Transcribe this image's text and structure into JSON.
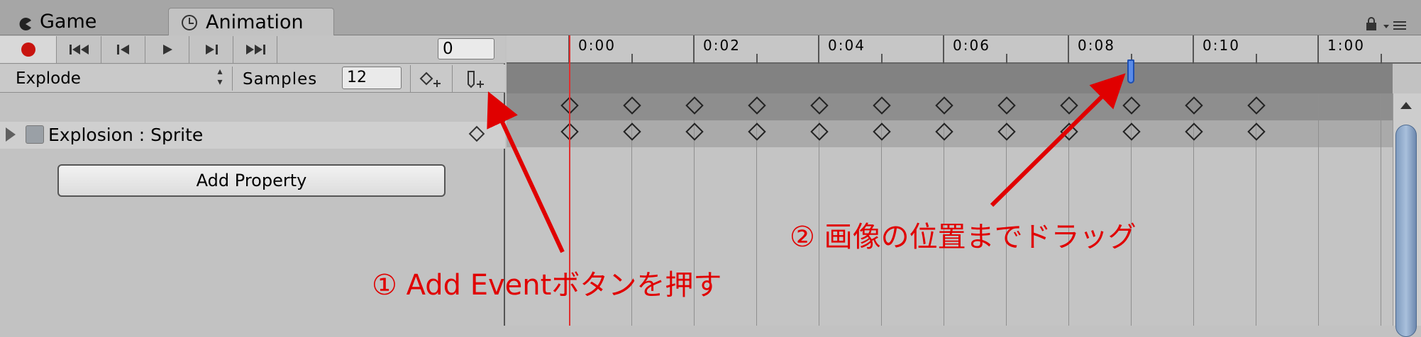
{
  "tabs": [
    {
      "label": "Game",
      "icon": "pacman-icon"
    },
    {
      "label": "Animation",
      "icon": "clock-icon",
      "active": true
    }
  ],
  "controls": {
    "frame_value": "0",
    "clip_name": "Explode",
    "samples_label": "Samples",
    "samples_value": "12"
  },
  "property": {
    "label": "Explosion : Sprite",
    "icon": "sprite-renderer-icon"
  },
  "add_property_label": "Add Property",
  "ruler_labels": [
    "0:00",
    "0:02",
    "0:04",
    "0:06",
    "0:08",
    "0:10",
    "1:00"
  ],
  "keyframe_frames": [
    0,
    1,
    2,
    3,
    4,
    5,
    6,
    7,
    8,
    9,
    10,
    11
  ],
  "event_frame": 9,
  "annotations": {
    "add_event": "① Add Eventボタンを押す",
    "drag": "② 画像の位置までドラッグ"
  },
  "colors": {
    "playhead": "#e03030",
    "annotation": "#e00000",
    "event_marker": "#5a8be8"
  }
}
